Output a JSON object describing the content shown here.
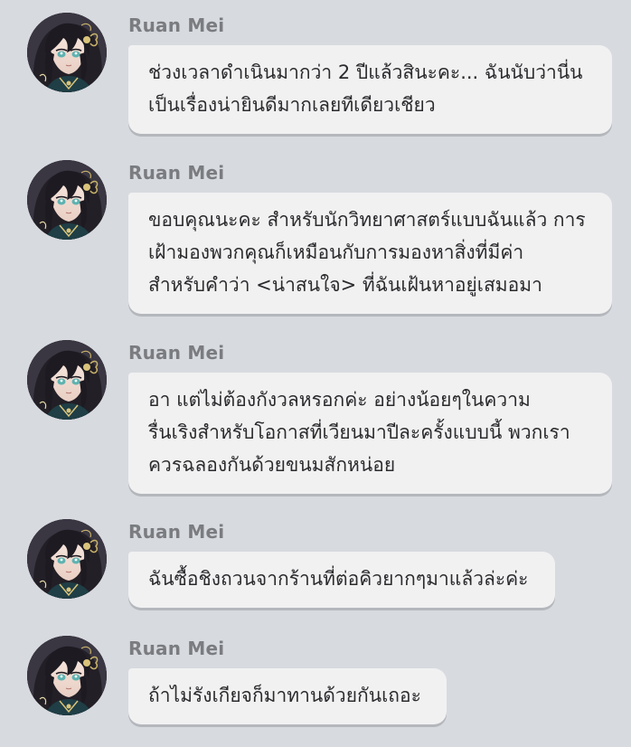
{
  "colors": {
    "background": "#d7dadf",
    "bubble": "#f1f1f2",
    "speaker_name": "#7a7c80",
    "text": "#2b2b2e"
  },
  "avatar_icon": "character-portrait-icon",
  "messages": [
    {
      "speaker": "Ruan Mei",
      "lines": [
        "ช่วงเวลาดำเนินมากว่า 2 ปีแล้วสินะคะ... ฉันนับว่านี่น",
        "เป็นเรื่องน่ายินดีมากเลยทีเดียวเชียว"
      ]
    },
    {
      "speaker": "Ruan Mei",
      "lines": [
        "ขอบคุณนะคะ สำหรับนักวิทยาศาสตร์แบบฉันแล้ว การ",
        "เฝ้ามองพวกคุณก็เหมือนกับการมองหาสิ่งที่มีค่า",
        "สำหรับคำว่า <น่าสนใจ> ที่ฉันเฝ้นหาอยู่เสมอมา"
      ]
    },
    {
      "speaker": "Ruan Mei",
      "lines": [
        "อา แต่ไม่ต้องกังวลหรอกค่ะ อย่างน้อยๆในความ",
        "รื่นเริงสำหรับโอกาสที่เวียนมาปีละครั้งแบบนี้ พวกเรา",
        "ควรฉลองกันด้วยขนมสักหน่อย"
      ]
    },
    {
      "speaker": "Ruan Mei",
      "lines": [
        "ฉันซื้อชิงถวนจากร้านที่ต่อคิวยากๆมาแล้วล่ะค่ะ"
      ]
    },
    {
      "speaker": "Ruan Mei",
      "lines": [
        "ถ้าไม่รังเกียจก็มาทานด้วยกันเถอะ"
      ]
    }
  ]
}
